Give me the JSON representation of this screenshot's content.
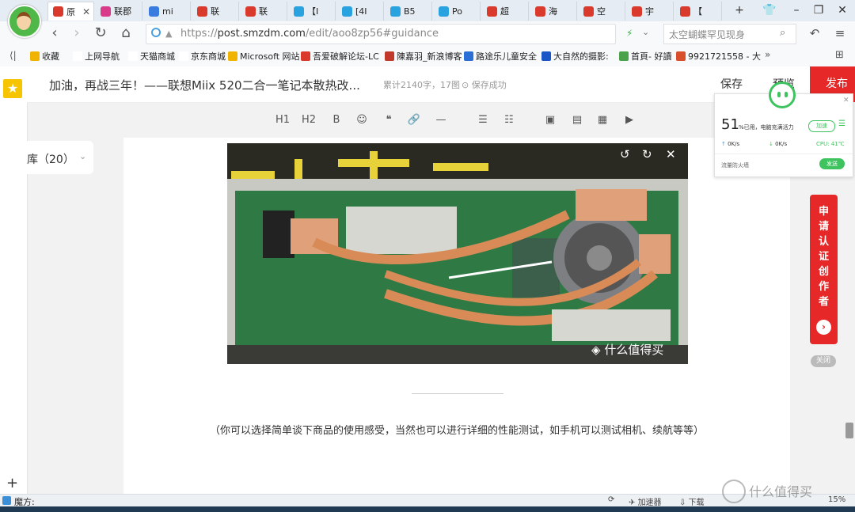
{
  "tabs": [
    {
      "label": "原",
      "color": "#d93a2b",
      "active": true
    },
    {
      "label": "联郡",
      "color": "#d93a8a"
    },
    {
      "label": "mi",
      "color": "#3a7be0"
    },
    {
      "label": "联",
      "color": "#d93a2b"
    },
    {
      "label": "联",
      "color": "#d93a2b"
    },
    {
      "label": "【I",
      "color": "#29a3e0"
    },
    {
      "label": "[4I",
      "color": "#29a3e0"
    },
    {
      "label": "B5",
      "color": "#29a3e0"
    },
    {
      "label": "Po",
      "color": "#29a3e0"
    },
    {
      "label": "超",
      "color": "#d93a2b"
    },
    {
      "label": "海",
      "color": "#d93a2b"
    },
    {
      "label": "空",
      "color": "#d93a2b"
    },
    {
      "label": "宇",
      "color": "#d93a2b"
    },
    {
      "label": "【",
      "color": "#d93a2b"
    }
  ],
  "address_bar": {
    "scheme": "https://",
    "host": "post.smzdm.com",
    "path": "/edit/aoo8zp56#guidance"
  },
  "search_placeholder": "太空蝴蝶罕见现身",
  "bookmarks": [
    {
      "label": "收藏",
      "color": "#f0b400"
    },
    {
      "label": "上网导航",
      "color": "#ffffff"
    },
    {
      "label": "天猫商城",
      "color": "#ffffff"
    },
    {
      "label": "京东商城",
      "color": "#ffffff"
    },
    {
      "label": "Microsoft 网站",
      "color": "#f0b400"
    },
    {
      "label": "吾爱破解论坛-LC",
      "color": "#d93a2b"
    },
    {
      "label": "陳嘉羽_新浪博客",
      "color": "#c0392b"
    },
    {
      "label": "路途乐儿童安全",
      "color": "#2a6fd6"
    },
    {
      "label": "大自然的摄影:",
      "color": "#1a56c8"
    },
    {
      "label": "首頁- 好讀",
      "color": "#4aa24a"
    },
    {
      "label": "9921721558 - 大",
      "color": "#d94f2b"
    }
  ],
  "editor": {
    "title": "加油，再战三年！——联想Miix 520二合一笔记本散热改...",
    "word_count": "累计2140字，17图",
    "saved_state": "保存成功",
    "save_label": "保存",
    "preview_label": "预览",
    "publish_label": "发布"
  },
  "toolbar_icons": [
    "H1",
    "H2",
    "B",
    "☺",
    "❝",
    "🔗",
    "—",
    "☰",
    "☷",
    "▣",
    "▤",
    "▦",
    "▶"
  ],
  "library": {
    "label": "库（20）"
  },
  "content": {
    "image_watermark": "什么值得买",
    "hint": "（你可以选择简单谈下商品的使用感受，当然也可以进行详细的性能测试，如手机可以测试相机、续航等等）"
  },
  "popup": {
    "percent": "51",
    "percent_sub": "%已用，电脑充满活力",
    "accelerate_label": "加速",
    "upload": "0K/s",
    "download": "0K/s",
    "cpu": "CPU: 41℃",
    "firewall_label": "流量防火墙",
    "send_label": "发送"
  },
  "cert_banner": {
    "text": "申请认证创作者",
    "close_label": "关闭"
  },
  "status": {
    "text": "魔方:",
    "accelerator": "加速器",
    "download": "下载",
    "zoom": "15%"
  },
  "watermark_text": "什么值得买"
}
